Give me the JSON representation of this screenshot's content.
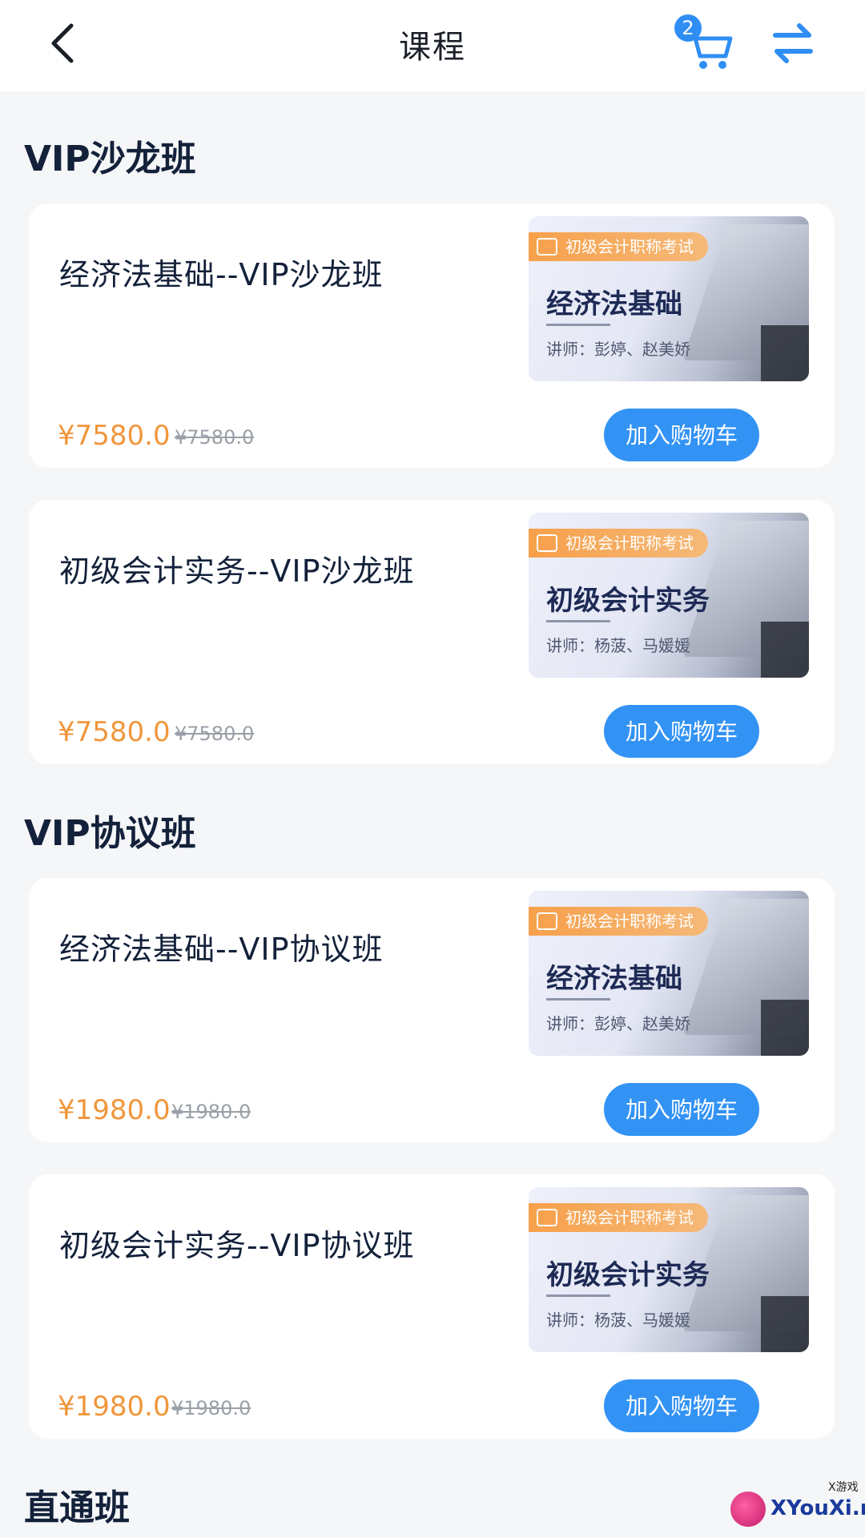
{
  "header": {
    "title": "课程",
    "cart_count": "2"
  },
  "sections": [
    {
      "title": "VIP沙龙班",
      "courses": [
        {
          "name": "经济法基础--VIP沙龙班",
          "price": "¥7580.0",
          "original_price": "¥7580.0",
          "button": "加入购物车",
          "thumb": {
            "tag": "初级会计职称考试",
            "title": "经济法基础",
            "teacher": "讲师：彭婷、赵美娇"
          }
        },
        {
          "name": "初级会计实务--VIP沙龙班",
          "price": "¥7580.0",
          "original_price": "¥7580.0",
          "button": "加入购物车",
          "thumb": {
            "tag": "初级会计职称考试",
            "title": "初级会计实务",
            "teacher": "讲师：杨菠、马媛媛"
          }
        }
      ]
    },
    {
      "title": "VIP协议班",
      "courses": [
        {
          "name": "经济法基础--VIP协议班",
          "price": "¥1980.0",
          "original_price": "¥1980.0",
          "button": "加入购物车",
          "thumb": {
            "tag": "初级会计职称考试",
            "title": "经济法基础",
            "teacher": "讲师：彭婷、赵美娇"
          }
        },
        {
          "name": "初级会计实务--VIP协议班",
          "price": "¥1980.0",
          "original_price": "¥1980.0",
          "button": "加入购物车",
          "thumb": {
            "tag": "初级会计职称考试",
            "title": "初级会计实务",
            "teacher": "讲师：杨菠、马媛媛"
          }
        }
      ]
    },
    {
      "title": "直通班",
      "courses": []
    }
  ],
  "watermark": {
    "text": "XYouXi.net",
    "small": "X游戏"
  },
  "colors": {
    "accent": "#3393f5",
    "price": "#f0963c",
    "background": "#f5f6f8"
  },
  "icons": {
    "back": "chevron-left-icon",
    "cart": "cart-icon",
    "switch": "swap-arrows-icon"
  }
}
